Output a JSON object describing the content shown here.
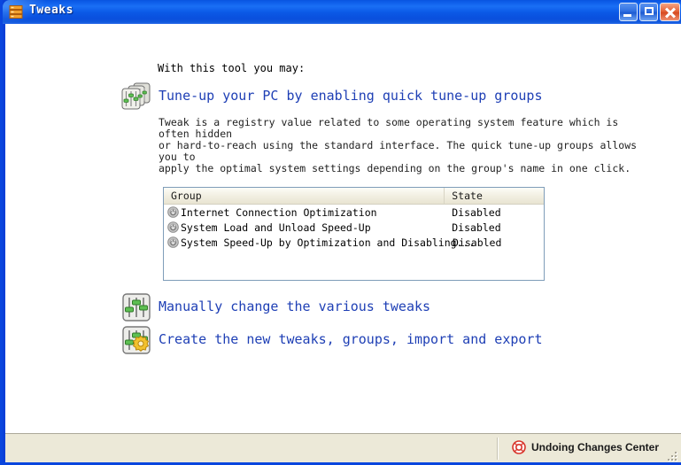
{
  "window": {
    "title": "Tweaks",
    "title_icon": "stacked-bars-icon",
    "controls": {
      "minimize": "Minimize",
      "maximize": "Maximize",
      "close": "Close"
    }
  },
  "content": {
    "intro": "With this tool you may:",
    "features": [
      {
        "icon": "stacked-equalizer-icon",
        "link": "Tune-up your PC by enabling quick tune-up groups"
      },
      {
        "icon": "equalizer-sliders-icon",
        "link": "Manually change the various tweaks"
      },
      {
        "icon": "equalizer-gear-icon",
        "link": "Create the new tweaks, groups, import and export"
      }
    ],
    "description": "Tweak is a registry value related to some operating system feature which is often hidden\nor hard-to-reach using the standard interface. The quick tune-up groups allows you to\napply the optimal system settings depending on the group's name in one click."
  },
  "listview": {
    "columns": [
      "Group",
      "State"
    ],
    "rows": [
      {
        "icon": "power-circle-icon",
        "group": "Internet Connection Optimization",
        "state": "Disabled"
      },
      {
        "icon": "power-circle-icon",
        "group": "System Load and Unload Speed-Up",
        "state": "Disabled"
      },
      {
        "icon": "power-circle-icon",
        "group": "System Speed-Up by Optimization and Disabling...",
        "state": "Disabled"
      }
    ]
  },
  "statusbar": {
    "item_icon": "lifebuoy-icon",
    "item_label": "Undoing Changes Center"
  },
  "colors": {
    "link": "#1e3fb5",
    "titlebar": "#0a4fdd",
    "status_bg": "#ece9d8",
    "listview_border": "#7f9db9"
  }
}
